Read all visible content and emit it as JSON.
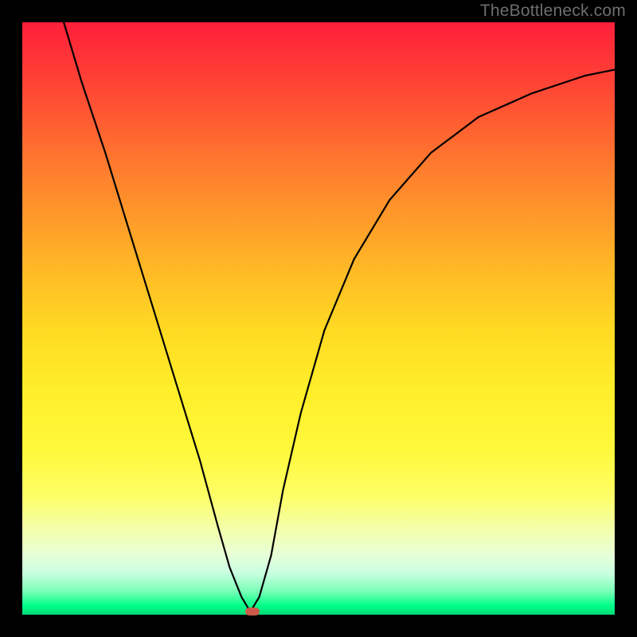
{
  "watermark": "TheBottleneck.com",
  "chart_data": {
    "type": "line",
    "title": "",
    "xlabel": "",
    "ylabel": "",
    "xlim": [
      0,
      100
    ],
    "ylim": [
      0,
      100
    ],
    "grid": false,
    "legend": false,
    "series": [
      {
        "name": "curve",
        "x": [
          7,
          10,
          14,
          18,
          22,
          26,
          30,
          33,
          35,
          37,
          38.5,
          40,
          42,
          44,
          47,
          51,
          56,
          62,
          69,
          77,
          86,
          95,
          100
        ],
        "y": [
          100,
          90,
          78,
          65,
          52,
          39,
          26,
          15,
          8,
          3,
          0.5,
          3,
          10,
          21,
          34,
          48,
          60,
          70,
          78,
          84,
          88,
          91,
          92
        ]
      }
    ],
    "marker": {
      "x": 38.8,
      "y": 0.5,
      "color": "#cc5a4a"
    },
    "colors": {
      "curve": "#000000",
      "gradient_top": "#ff1f3a",
      "gradient_bottom": "#00d877",
      "marker": "#cc5a4a",
      "frame": "#000000"
    }
  }
}
